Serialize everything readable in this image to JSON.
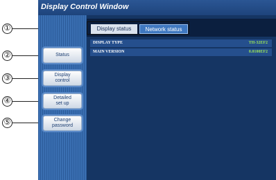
{
  "window": {
    "title": "Display Control Window"
  },
  "tabs": [
    {
      "label": "Display status"
    },
    {
      "label": "Network status"
    }
  ],
  "nav": [
    {
      "label": "Status"
    },
    {
      "label": "Display\ncontrol"
    },
    {
      "label": "Detailed\nset up"
    },
    {
      "label": "Change\npassword"
    }
  ],
  "info": [
    {
      "key": "DISPLAY TYPE",
      "value": "TH-32EF2"
    },
    {
      "key": "MAIN VERSION",
      "value": "0.0100EF2"
    }
  ],
  "callouts": [
    "①",
    "②",
    "③",
    "④",
    "⑤"
  ]
}
